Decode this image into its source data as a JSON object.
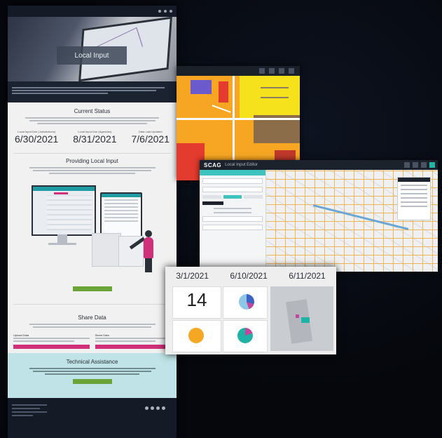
{
  "main_page": {
    "hero_title": "Local Input",
    "status_title": "Current Status",
    "dates": [
      {
        "label": "Local Input Due (Jurisdictions)",
        "value": "6/30/2021"
      },
      {
        "label": "Local Input Due (Agencies)",
        "value": "8/31/2021"
      },
      {
        "label": "Data Last Updated",
        "value": "7/6/2021"
      }
    ],
    "providing_title": "Providing Local Input",
    "share_title": "Share Data",
    "share_cards": [
      {
        "title": "Upload Data"
      },
      {
        "title": "Share Data"
      }
    ],
    "tech_title": "Technical Assistance"
  },
  "editor": {
    "logo": "SCAG",
    "title": "Local Input Editor"
  },
  "dashboard": {
    "dates": [
      "3/1/2021",
      "6/10/2021",
      "6/11/2021"
    ],
    "count": "14"
  },
  "colors": {
    "pink": "#d0307a",
    "teal": "#3fc3bf",
    "green": "#6ba53a",
    "zoning_orange": "#f6a623",
    "zoning_yellow": "#f6e21c"
  }
}
